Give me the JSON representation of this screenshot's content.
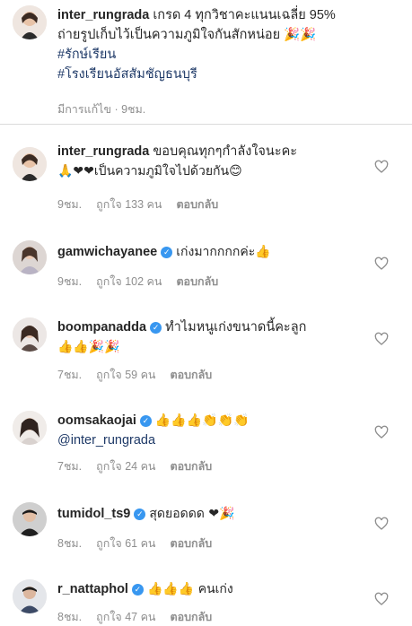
{
  "caption": {
    "username": "inter_rungrada",
    "line1": "เกรด 4 ทุกวิชาคะแนนเฉลี่ย 95%",
    "line2": "ถ่ายรูปเก็บไว้เป็นความภูมิใจกันสักหน่อย 🎉🎉",
    "hashtag1": "#รักษ์เรียน",
    "hashtag2": "#โรงเรียนอัสสัมชัญธนบุรี",
    "edited": "มีการแก้ไข · 9ชม."
  },
  "comments": [
    {
      "username": "inter_rungrada",
      "verified": false,
      "text": "ขอบคุณทุกๆกำลังใจนะคะ",
      "text2": "🙏❤❤เป็นความภูมิใจไปด้วยกัน😊",
      "time": "9ชม.",
      "likes": "ถูกใจ 133 คน",
      "reply": "ตอบกลับ"
    },
    {
      "username": "gamwichayanee",
      "verified": true,
      "text": "เก่งมากกกกค่ะ👍",
      "time": "9ชม.",
      "likes": "ถูกใจ 102 คน",
      "reply": "ตอบกลับ"
    },
    {
      "username": "boompanadda",
      "verified": true,
      "text": "ทำไมหนูเก่งขนาดนี้คะลูก",
      "text2": "👍👍🎉🎉",
      "time": "7ชม.",
      "likes": "ถูกใจ 59 คน",
      "reply": "ตอบกลับ"
    },
    {
      "username": "oomsakaojai",
      "verified": true,
      "text": "👍👍👍👏👏👏",
      "mention": "@inter_rungrada",
      "time": "7ชม.",
      "likes": "ถูกใจ 24 คน",
      "reply": "ตอบกลับ"
    },
    {
      "username": "tumidol_ts9",
      "verified": true,
      "text": "สุดยอดดด ❤🎉",
      "time": "8ชม.",
      "likes": "ถูกใจ 61 คน",
      "reply": "ตอบกลับ"
    },
    {
      "username": "r_nattaphol",
      "verified": true,
      "text": "👍👍👍 คนเก่ง",
      "time": "8ชม.",
      "likes": "ถูกใจ 47 คน",
      "reply": "ตอบกลับ"
    }
  ],
  "colors": {
    "username": "#262626",
    "hashtag": "#1f3a68",
    "meta": "#8e8e8e",
    "verified": "#3897f0",
    "divider": "#dbdbdb"
  },
  "icons": {
    "like": "heart-outline-icon",
    "verified": "verified-badge-icon"
  }
}
